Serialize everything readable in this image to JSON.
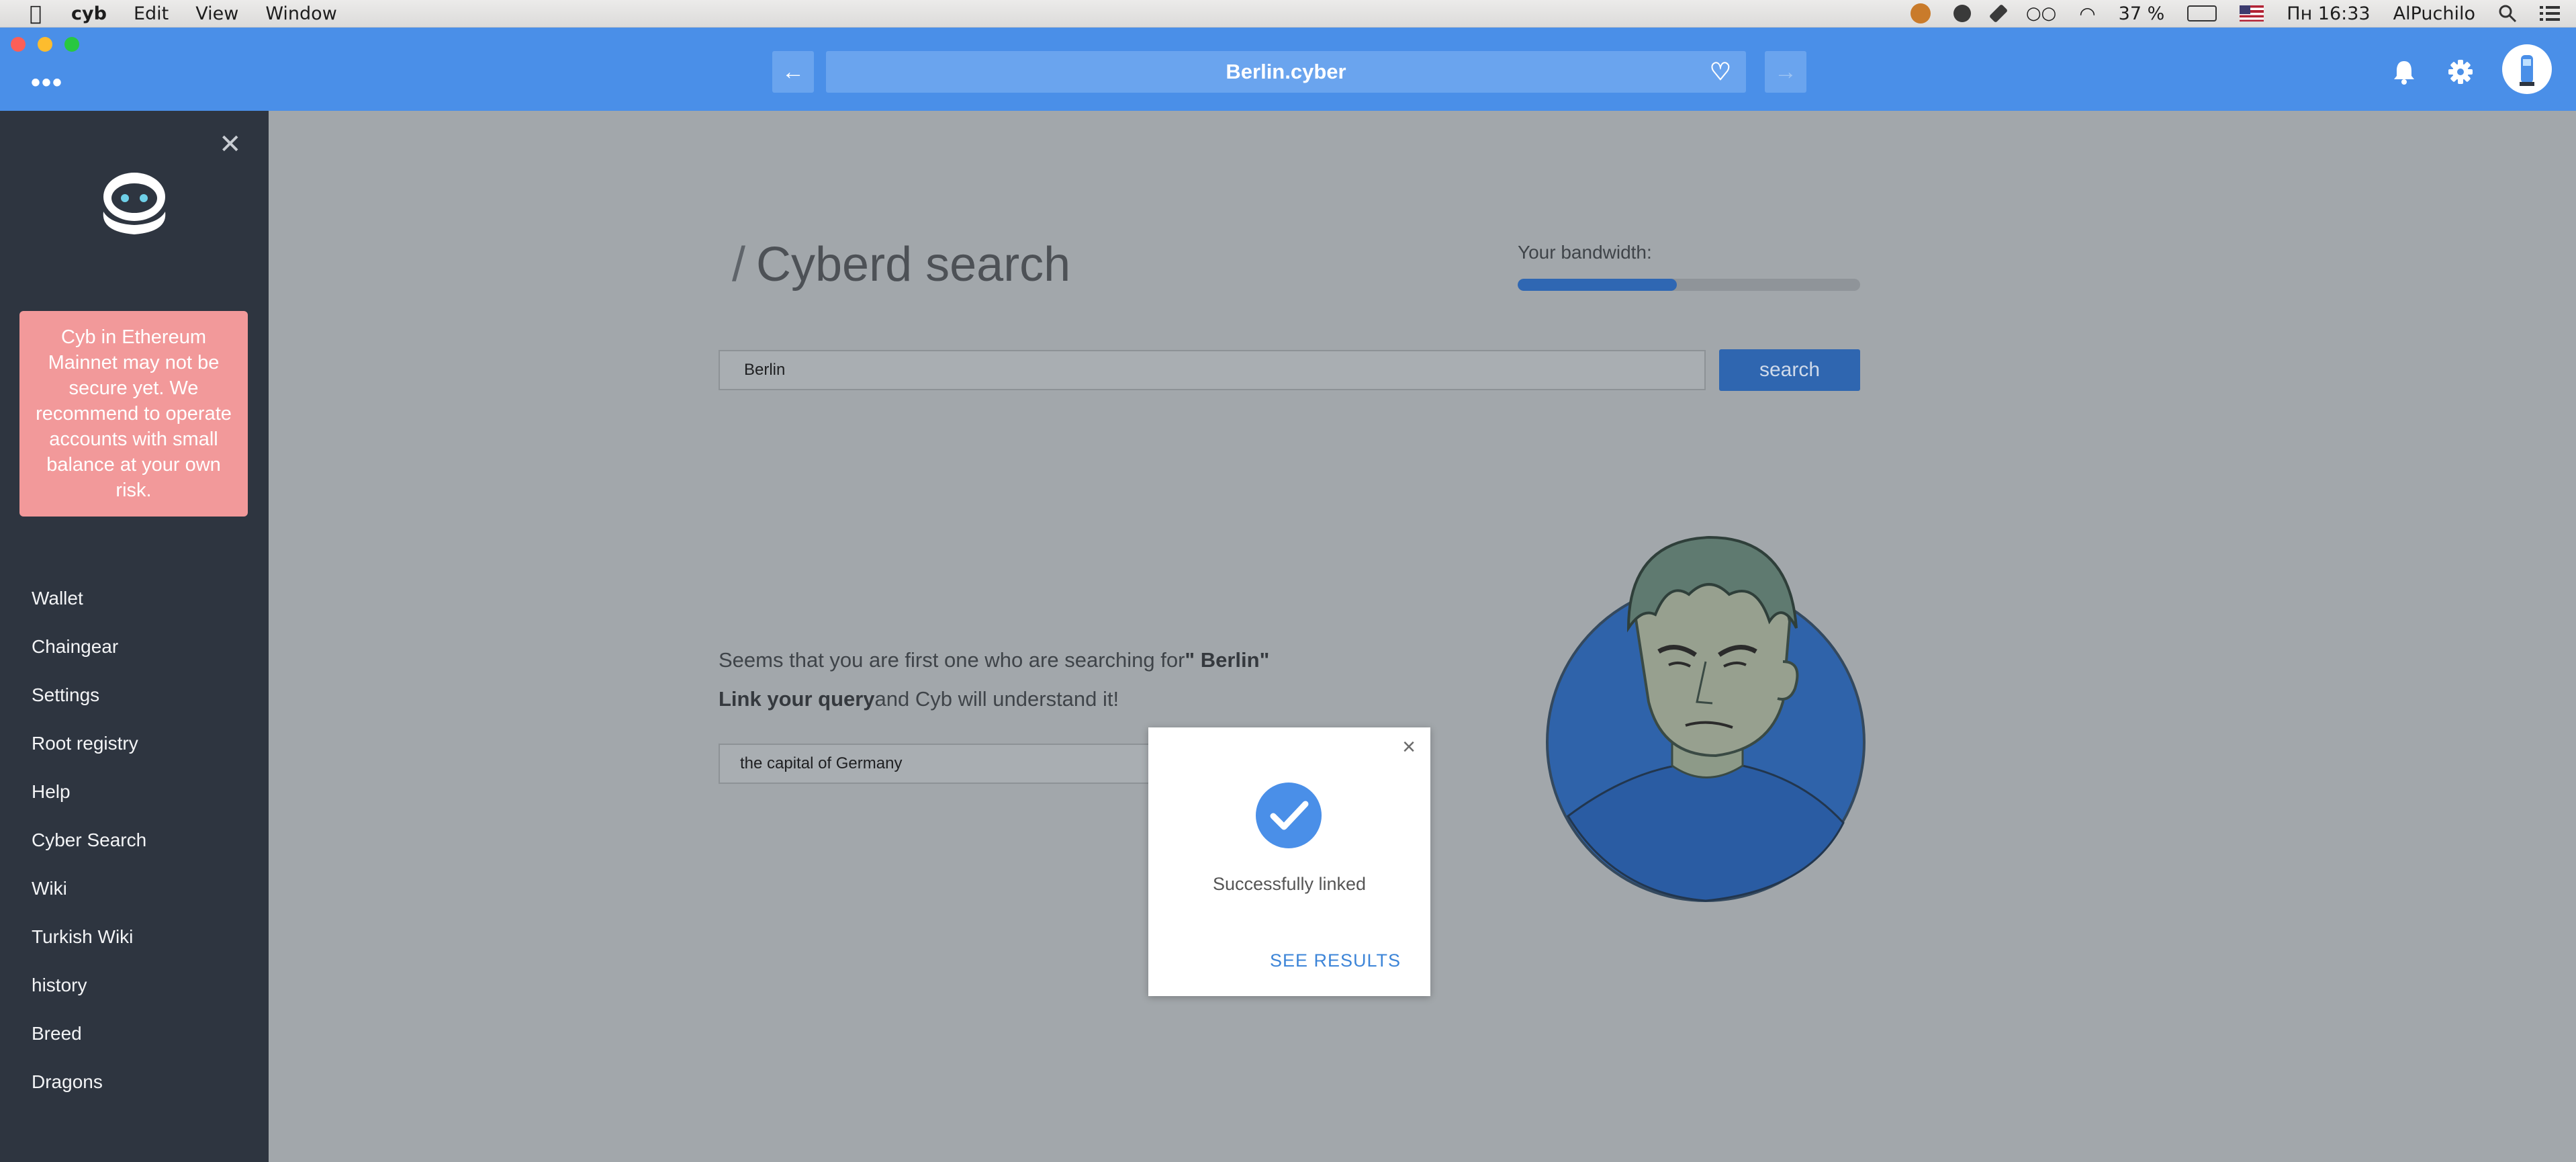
{
  "menubar": {
    "app_name": "cyb",
    "menus": [
      "Edit",
      "View",
      "Window"
    ],
    "battery": "37 %",
    "clock": "Пн 16:33",
    "user": "AlPuchilo"
  },
  "header": {
    "url": "Berlin.cyber",
    "icons": [
      "back-arrow-icon",
      "heart-icon",
      "forward-arrow-icon",
      "bell-icon",
      "gear-icon"
    ]
  },
  "sidebar": {
    "warning": "Cyb in Ethereum Mainnet may not be secure yet. We recommend to operate accounts with small balance at your own risk.",
    "items": [
      "Wallet",
      "Chaingear",
      "Settings",
      "Root registry",
      "Help",
      "Cyber Search",
      "Wiki",
      "Turkish Wiki",
      "history",
      "Breed",
      "Dragons"
    ]
  },
  "main": {
    "title": "Cyberd search",
    "bandwidth_label": "Your bandwidth:",
    "bandwidth_fraction": 0.465,
    "search_value": "Berlin",
    "search_button": "search",
    "msg_prefix": "Seems that you are first one who are searching for",
    "msg_query": "\" Berlin\"",
    "link_bold": "Link your query",
    "link_rest": "and Cyb will understand it!",
    "link_value": "the capital of Germany"
  },
  "modal": {
    "message": "Successfully linked",
    "action": "SEE RESULTS"
  },
  "colors": {
    "accent": "#4a8fe8",
    "sidebar": "#2e3540",
    "warning": "#f2999a",
    "button": "#2f66b0"
  }
}
